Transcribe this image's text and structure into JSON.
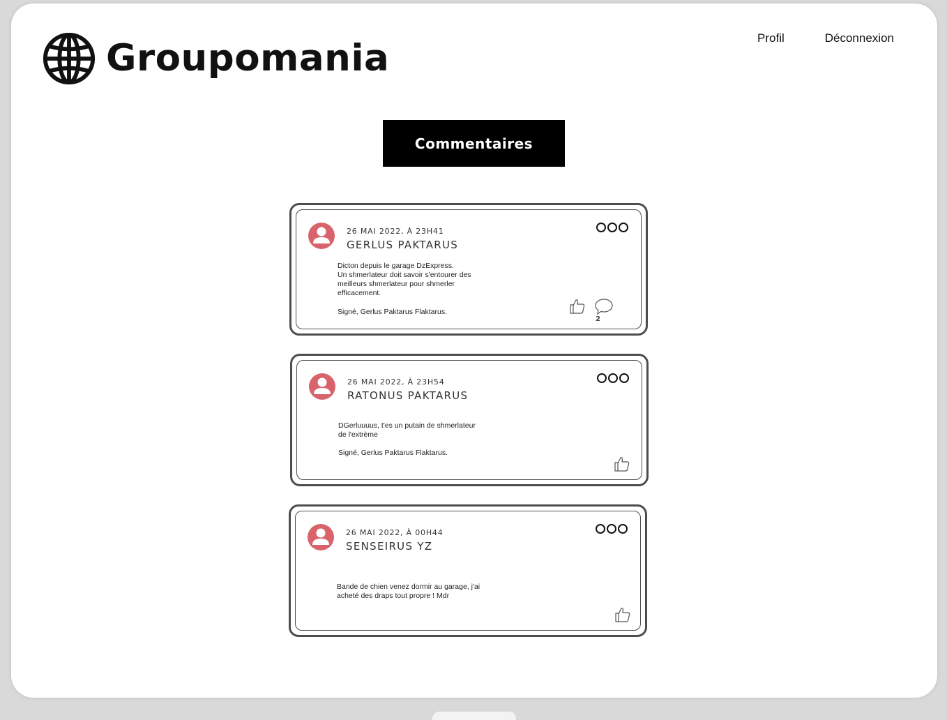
{
  "brand": {
    "name": "Groupomania",
    "logo_icon": "globe-icon"
  },
  "nav": {
    "profile": "Profil",
    "logout": "Déconnexion"
  },
  "page": {
    "title": "Commentaires"
  },
  "colors": {
    "accent_avatar": "#d9636a",
    "border": "#4d4d4d",
    "title_bg": "#000000"
  },
  "comments": [
    {
      "date": "26 MAI 2022, À 23H41",
      "author": "GERLUS PAKTARUS",
      "lines": [
        "Dicton depuis le garage DzExpress.",
        "Un shmerlateur doit savoir s'entourer des",
        "meilleurs shmerlateur pour shmerler",
        "efficacement."
      ],
      "signature": "Signé, Gerlus Paktarus Flaktarus.",
      "reply_count": "2"
    },
    {
      "date": "26 MAI 2022, À 23H54",
      "author": "RATONUS PAKTARUS",
      "lines": [
        "DGerluuuus, t'es un putain de shmerlateur",
        "de l'extrème"
      ],
      "signature": "Signé, Gerlus Paktarus Flaktarus."
    },
    {
      "date": "26 MAI 2022, À 00H44",
      "author": "SENSEIRUS YZ",
      "lines": [
        "Bande de chien venez dormir au garage, j'ai",
        "acheté des draps tout propre ! Mdr"
      ]
    }
  ]
}
